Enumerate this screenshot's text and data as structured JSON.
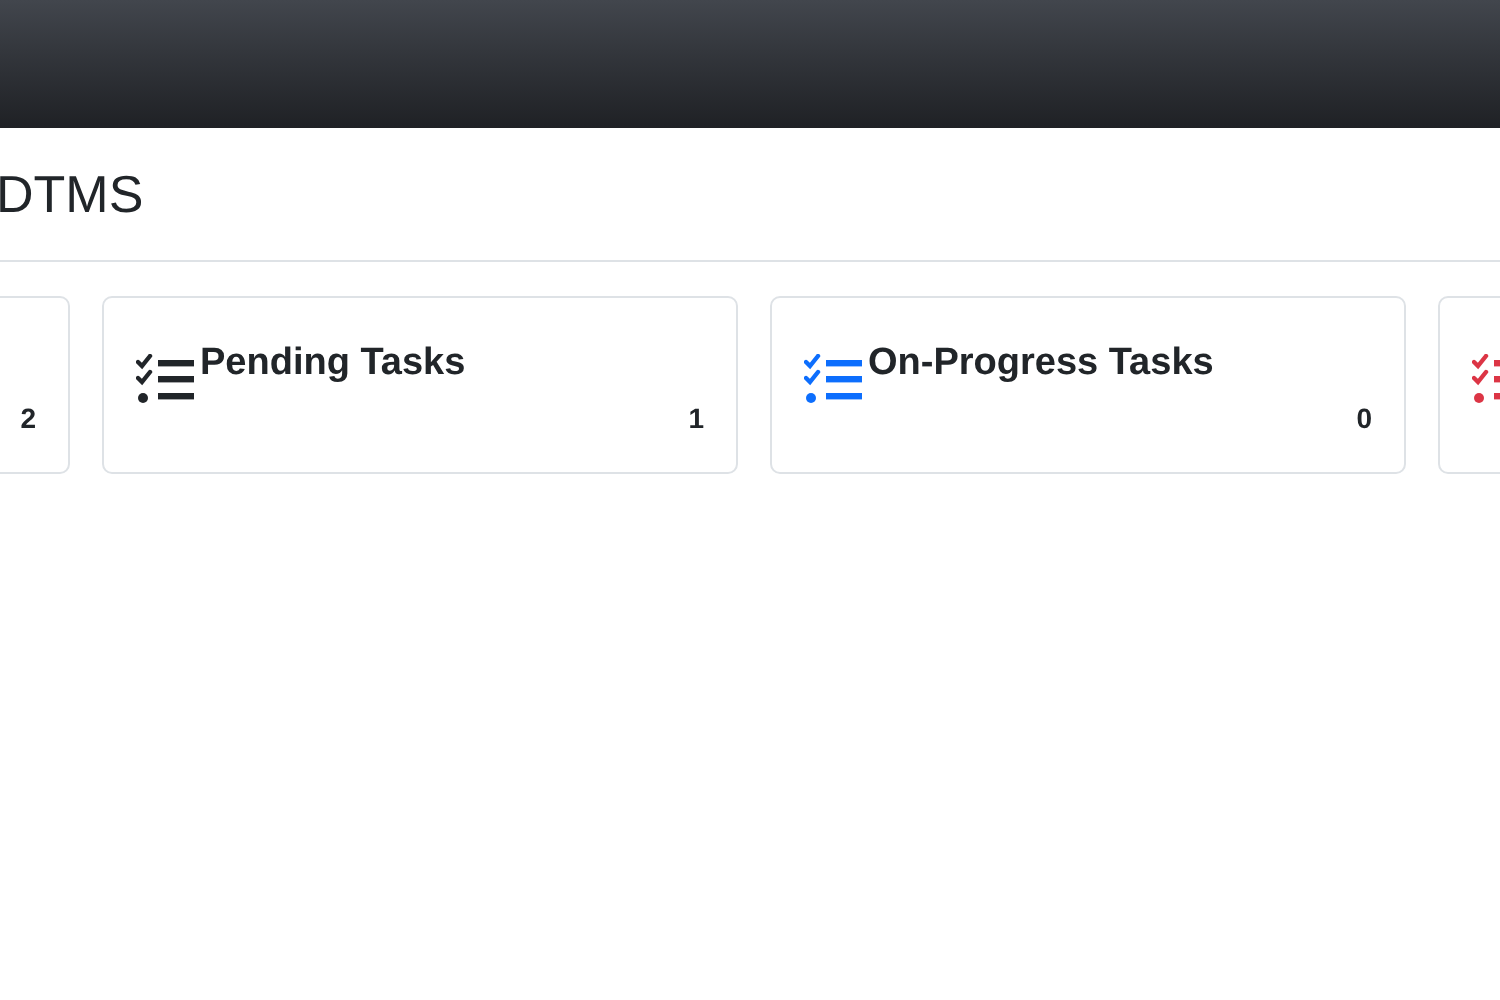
{
  "heading": "DTMS",
  "cards": [
    {
      "count": "2"
    },
    {
      "title": "Pending Tasks",
      "count": "1",
      "color": "#212529"
    },
    {
      "title": "On-Progress Tasks",
      "count": "0",
      "color": "#0d6efd"
    },
    {
      "color": "#dc3545"
    }
  ]
}
